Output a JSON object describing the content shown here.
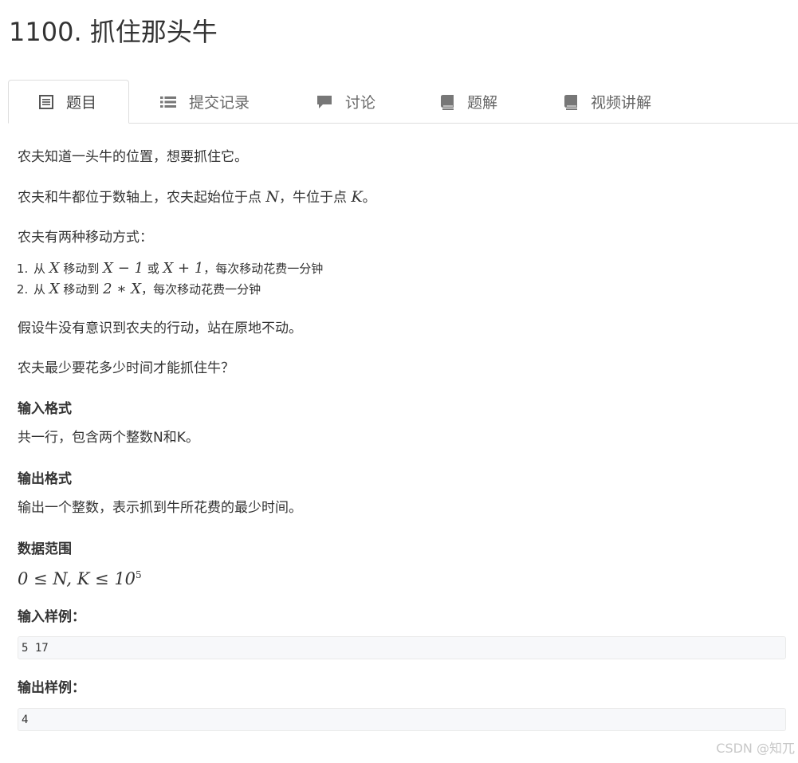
{
  "problem": {
    "title": "1100. 抓住那头牛"
  },
  "tabs": [
    {
      "label": "题目",
      "icon": "list-doc-icon",
      "active": true
    },
    {
      "label": "提交记录",
      "icon": "list-icon",
      "active": false
    },
    {
      "label": "讨论",
      "icon": "comment-icon",
      "active": false
    },
    {
      "label": "题解",
      "icon": "book-icon",
      "active": false
    },
    {
      "label": "视频讲解",
      "icon": "book-icon",
      "active": false
    }
  ],
  "description": {
    "p1": "农夫知道一头牛的位置，想要抓住它。",
    "p2": {
      "a": "农夫和牛都位于数轴上，农夫起始位于点 ",
      "N": "N",
      "b": "，牛位于点 ",
      "K": "K",
      "c": "。"
    },
    "p3": "农夫有两种移动方式：",
    "moves": [
      {
        "a": "从 ",
        "x1": "X",
        "b": " 移动到 ",
        "e1": "X − 1",
        "c": " 或 ",
        "e2": "X + 1",
        "d": "，每次移动花费一分钟"
      },
      {
        "a": "从 ",
        "x1": "X",
        "b": " 移动到 ",
        "e1": "2 ∗ X",
        "d": "，每次移动花费一分钟"
      }
    ],
    "p4": "假设牛没有意识到农夫的行动，站在原地不动。",
    "p5": "农夫最少要花多少时间才能抓住牛？"
  },
  "input_format": {
    "heading": "输入格式",
    "text": "共一行，包含两个整数N和K。"
  },
  "output_format": {
    "heading": "输出格式",
    "text": "输出一个整数，表示抓到牛所花费的最少时间。"
  },
  "range": {
    "heading": "数据范围",
    "formula": "0 ≤ N, K ≤ 10",
    "exponent": "5"
  },
  "sample_input": {
    "heading": "输入样例：",
    "value": "5 17"
  },
  "sample_output": {
    "heading": "输出样例：",
    "value": "4"
  },
  "watermark": "CSDN @知兀"
}
